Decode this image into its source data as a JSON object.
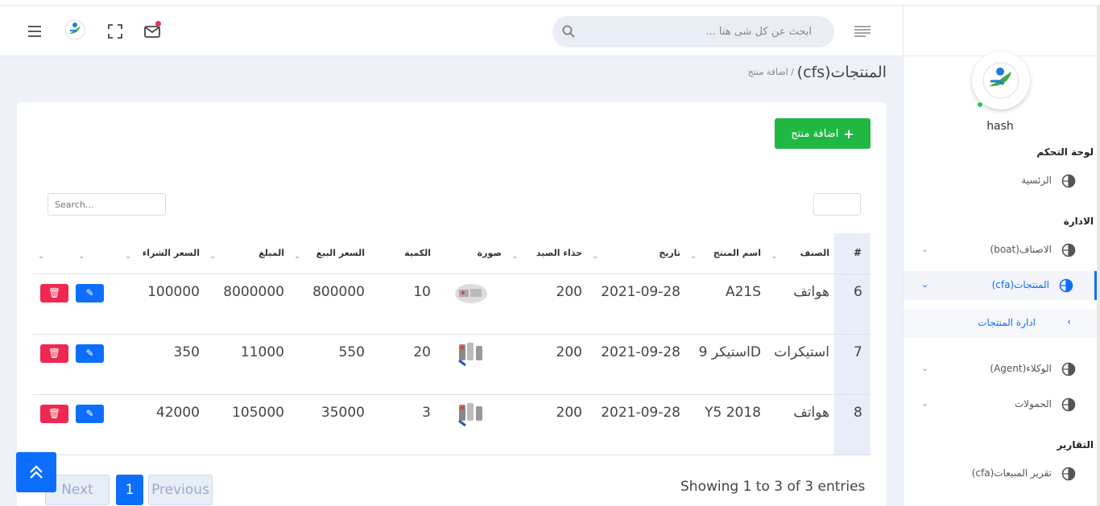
{
  "header": {
    "search_placeholder": "ابحث عن كل شى هنا ...",
    "icons": [
      "menu-icon",
      "logo-icon",
      "fullscreen-icon",
      "mail-icon",
      "lines-icon",
      "search-icon"
    ]
  },
  "sidebar": {
    "user_name": "hash",
    "section_dashboard": "لوحة التحكم",
    "home": "الرئسية",
    "section_admin": "الادارة",
    "categories": "الاصناف(boat)",
    "products": "المنتجات(cfa)",
    "manage_products": "ادارة المنتجات",
    "agents": "الوكلاء(Agent)",
    "shipments": "الحمولات",
    "section_reports": "التقارير",
    "sales_report": "تقرير المبيعات(cfa)"
  },
  "page": {
    "title": "(cfs)المنتجات",
    "breadcrumb": "/ اضافة منتج"
  },
  "card": {
    "add_button": "اضافة منتج",
    "search_placeholder": "Search...",
    "columns": {
      "num": "#",
      "category": "الصنف",
      "product_name": "اسم المنتج",
      "date": "تاريخ",
      "boot_shoe": "حذاء الصيد",
      "image": "صورة",
      "qty": "الكمية",
      "sale_price": "السعر البيع",
      "amount": "المبلغ",
      "buy_price": "السعر الشراء"
    },
    "rows": [
      {
        "num": "6",
        "category": "هواتف",
        "name": "A21S",
        "date": "2021-09-28",
        "boot": "200",
        "qty": "10",
        "sale": "800000",
        "amount": "8000000",
        "buy": "100000"
      },
      {
        "num": "7",
        "category": "استيكرات",
        "name": "استيكر 9D",
        "date": "2021-09-28",
        "boot": "200",
        "qty": "20",
        "sale": "550",
        "amount": "11000",
        "buy": "350"
      },
      {
        "num": "8",
        "category": "هواتف",
        "name": "Y5 2018",
        "date": "2021-09-28",
        "boot": "200",
        "qty": "3",
        "sale": "35000",
        "amount": "105000",
        "buy": "42000"
      }
    ],
    "info": "Showing 1 to 3 of 3 entries",
    "pagination": {
      "prev": "Previous",
      "page": "1",
      "next": "Next"
    }
  }
}
